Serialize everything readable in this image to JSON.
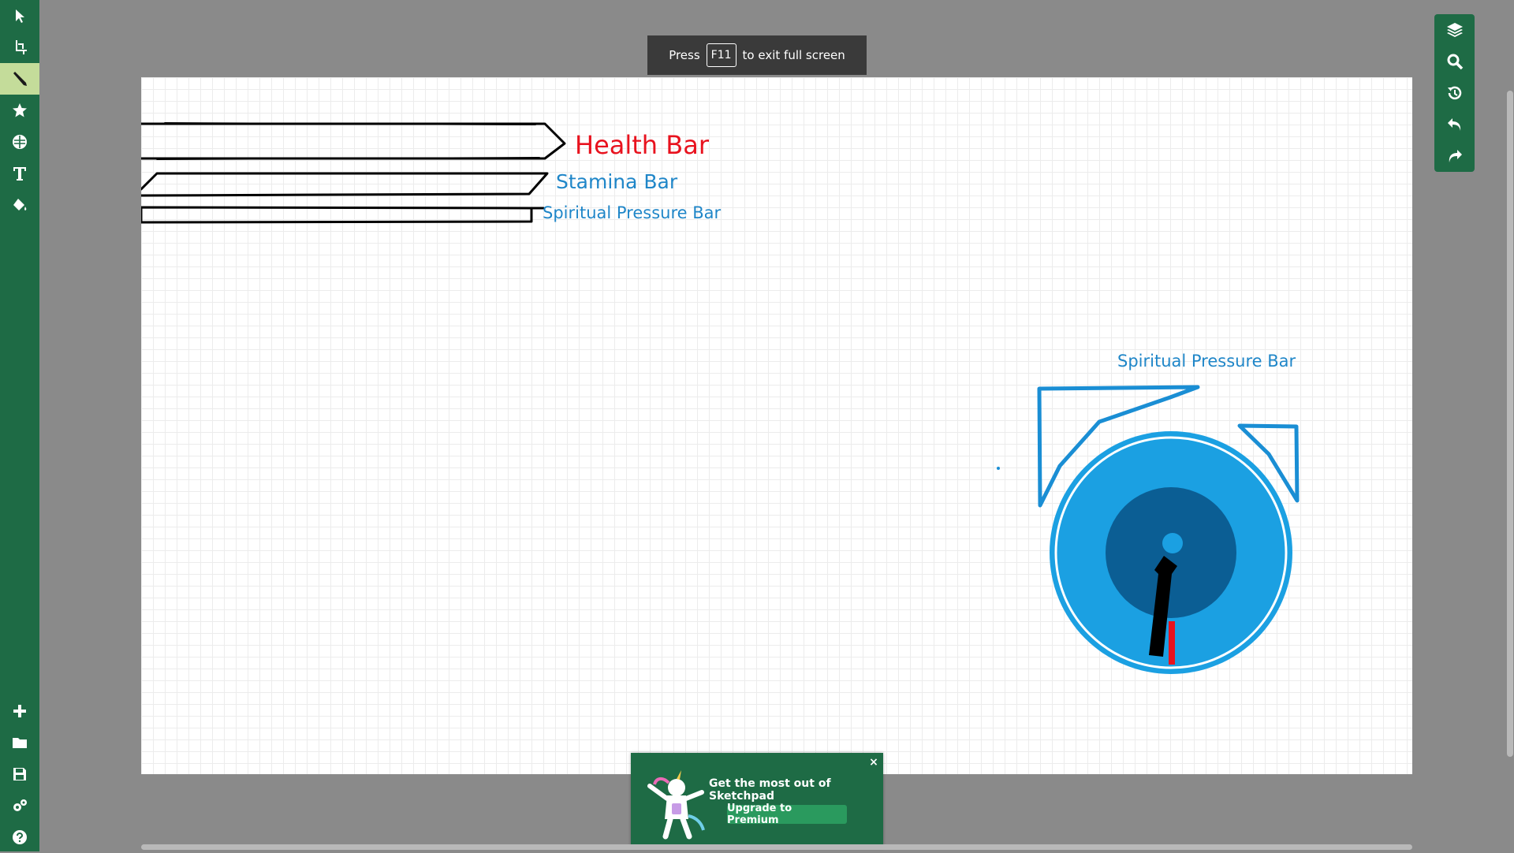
{
  "left_toolbar": {
    "tools": [
      {
        "name": "select",
        "icon": "cursor-arrow-icon"
      },
      {
        "name": "crop",
        "icon": "crop-icon"
      },
      {
        "name": "pen",
        "icon": "pen-icon",
        "active": true
      },
      {
        "name": "stickers",
        "icon": "star-icon"
      },
      {
        "name": "shapes",
        "icon": "globe-icon"
      },
      {
        "name": "text",
        "icon": "text-icon"
      },
      {
        "name": "fill",
        "icon": "paint-bucket-icon"
      }
    ],
    "bottom_tools": [
      {
        "name": "new",
        "icon": "plus-icon"
      },
      {
        "name": "open",
        "icon": "folder-icon"
      },
      {
        "name": "save",
        "icon": "save-icon"
      },
      {
        "name": "settings",
        "icon": "gears-icon"
      },
      {
        "name": "help",
        "icon": "help-icon"
      }
    ]
  },
  "right_toolbar": {
    "tools": [
      {
        "name": "layers",
        "icon": "layers-icon"
      },
      {
        "name": "zoom",
        "icon": "search-icon"
      },
      {
        "name": "history",
        "icon": "history-icon"
      },
      {
        "name": "undo",
        "icon": "undo-icon"
      },
      {
        "name": "redo",
        "icon": "redo-icon"
      }
    ]
  },
  "fullscreen_notice": {
    "prefix": "Press",
    "key": "F11",
    "suffix": "to exit full screen"
  },
  "canvas": {
    "labels": {
      "health_bar": "Health Bar",
      "stamina_bar": "Stamina Bar",
      "spiritual_pressure_bar_1": "Spiritual Pressure Bar",
      "spiritual_pressure_bar_2": "Spiritual Pressure Bar"
    },
    "colors": {
      "health": "#e8121e",
      "stamina": "#1f86c8",
      "gauge_outer": "#1ba0e2",
      "gauge_inner": "#0b5e94",
      "needle": "#000000",
      "marker": "#e8121e"
    }
  },
  "promo": {
    "title": "Get the most out of Sketchpad",
    "button": "Upgrade to Premium",
    "close": "×"
  }
}
